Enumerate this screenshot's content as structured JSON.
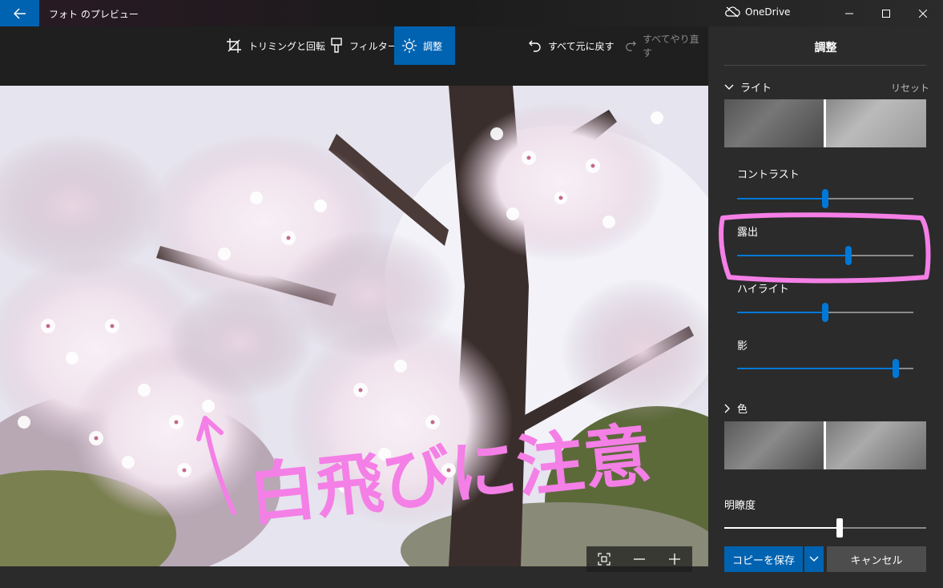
{
  "titlebar": {
    "app_title": "フォト のプレビュー",
    "cloud_label": "OneDrive",
    "icons": [
      "back-arrow-icon",
      "cloud-off-icon",
      "minimize-icon",
      "maximize-icon",
      "close-icon"
    ]
  },
  "toolbar": {
    "crop_label": "トリミングと回転",
    "filter_label": "フィルター",
    "adjust_label": "調整",
    "undo_all_label": "すべて元に戻す",
    "redo_all_label": "すべてやり直す"
  },
  "panel": {
    "title": "調整",
    "light": {
      "header": "ライト",
      "reset_label": "リセット",
      "sliders": [
        {
          "label": "コントラスト",
          "value": 0.5
        },
        {
          "label": "露出",
          "value": 0.63
        },
        {
          "label": "ハイライト",
          "value": 0.5
        },
        {
          "label": "影",
          "value": 0.9
        }
      ]
    },
    "color": {
      "header": "色"
    },
    "clarity": {
      "label": "明瞭度",
      "value": 0.57
    },
    "save_copy_label": "コピーを保存",
    "cancel_label": "キャンセル"
  },
  "annotation": {
    "handwritten_text": "白飛びに注意",
    "color": "#f47fe6"
  },
  "colors": {
    "accent": "#0063b1",
    "slider_blue": "#0078d7",
    "panel_bg": "#2b2b2b"
  }
}
